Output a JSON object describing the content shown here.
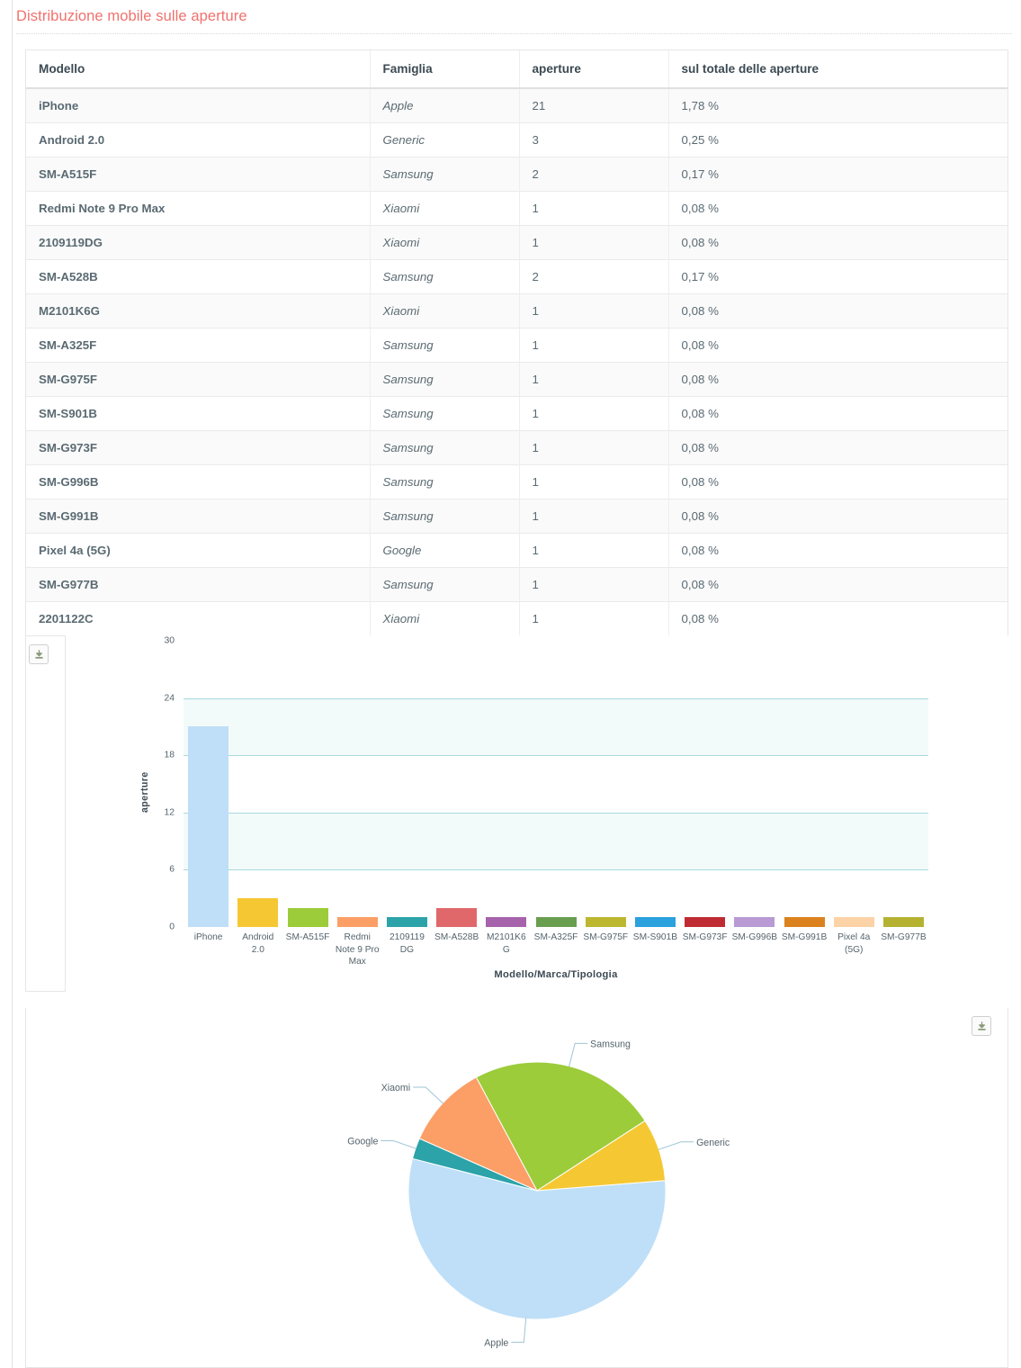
{
  "panel": {
    "title": "Distribuzione mobile sulle aperture"
  },
  "table": {
    "headers": {
      "model": "Modello",
      "family": "Famiglia",
      "count": "aperture",
      "pct": "sul totale delle aperture"
    },
    "rows": [
      {
        "model": "iPhone",
        "family": "Apple",
        "count": "21",
        "pct": "1,78 %"
      },
      {
        "model": "Android 2.0",
        "family": "Generic",
        "count": "3",
        "pct": "0,25 %"
      },
      {
        "model": "SM-A515F",
        "family": "Samsung",
        "count": "2",
        "pct": "0,17 %"
      },
      {
        "model": "Redmi Note 9 Pro Max",
        "family": "Xiaomi",
        "count": "1",
        "pct": "0,08 %"
      },
      {
        "model": "2109119DG",
        "family": "Xiaomi",
        "count": "1",
        "pct": "0,08 %"
      },
      {
        "model": "SM-A528B",
        "family": "Samsung",
        "count": "2",
        "pct": "0,17 %"
      },
      {
        "model": "M2101K6G",
        "family": "Xiaomi",
        "count": "1",
        "pct": "0,08 %"
      },
      {
        "model": "SM-A325F",
        "family": "Samsung",
        "count": "1",
        "pct": "0,08 %"
      },
      {
        "model": "SM-G975F",
        "family": "Samsung",
        "count": "1",
        "pct": "0,08 %"
      },
      {
        "model": "SM-S901B",
        "family": "Samsung",
        "count": "1",
        "pct": "0,08 %"
      },
      {
        "model": "SM-G973F",
        "family": "Samsung",
        "count": "1",
        "pct": "0,08 %"
      },
      {
        "model": "SM-G996B",
        "family": "Samsung",
        "count": "1",
        "pct": "0,08 %"
      },
      {
        "model": "SM-G991B",
        "family": "Samsung",
        "count": "1",
        "pct": "0,08 %"
      },
      {
        "model": "Pixel 4a (5G)",
        "family": "Google",
        "count": "1",
        "pct": "0,08 %"
      },
      {
        "model": "SM-G977B",
        "family": "Samsung",
        "count": "1",
        "pct": "0,08 %"
      },
      {
        "model": "2201122C",
        "family": "Xiaomi",
        "count": "1",
        "pct": "0,08 %"
      }
    ]
  },
  "bar_panel": {
    "download_icon": "download-icon"
  },
  "pie_panel": {
    "download_icon": "download-icon"
  },
  "chart_data": [
    {
      "type": "bar",
      "title": "",
      "xlabel": "Modello/Marca/Tipologia",
      "ylabel": "aperture",
      "ylim": [
        0,
        30
      ],
      "yticks": [
        0,
        6,
        12,
        18,
        24,
        30
      ],
      "grid": true,
      "legend": "none",
      "categories": [
        "iPhone",
        "Android 2.0",
        "SM-A515F",
        "Redmi Note 9 Pro Max",
        "2109119DG",
        "SM-A528B",
        "M2101K6G",
        "SM-A325F",
        "SM-G975F",
        "SM-S901B",
        "SM-G973F",
        "SM-G996B",
        "SM-G991B",
        "Pixel 4a (5G)",
        "SM-G977B"
      ],
      "tick_labels": [
        "iPhone",
        "Android 2.0",
        "SM-A515F",
        "Redmi Note 9 Pro Max",
        "2109119 DG",
        "SM-A528B",
        "M2101K6 G",
        "SM-A325F",
        "SM-G975F",
        "SM-S901B",
        "SM-G973F",
        "SM-G996B",
        "SM-G991B",
        "Pixel 4a (5G)",
        "SM-G977B"
      ],
      "values": [
        21,
        3,
        2,
        1,
        1,
        2,
        1,
        1,
        1,
        1,
        1,
        1,
        1,
        1,
        1
      ],
      "colors": [
        "#bedff7",
        "#f5c833",
        "#9ccc39",
        "#fb9f66",
        "#2ba3a9",
        "#e0686a",
        "#a663ab",
        "#699e4f",
        "#bcb72f",
        "#2ba1de",
        "#c02b33",
        "#b99ad4",
        "#db821f",
        "#fcd2a7",
        "#b5b232"
      ]
    },
    {
      "type": "pie",
      "title": "",
      "labels": [
        "Apple",
        "Google",
        "Xiaomi",
        "Samsung",
        "Generic"
      ],
      "values": [
        21,
        1,
        4,
        9,
        3
      ],
      "percents": [
        "55,3 %",
        "2,6 %",
        "10,5 %",
        "23,7 %",
        "7,9 %"
      ],
      "colors": [
        "#bedff7",
        "#2ba3a9",
        "#fb9f66",
        "#9ccc39",
        "#f5c833"
      ],
      "legend": "labels-outside"
    }
  ]
}
